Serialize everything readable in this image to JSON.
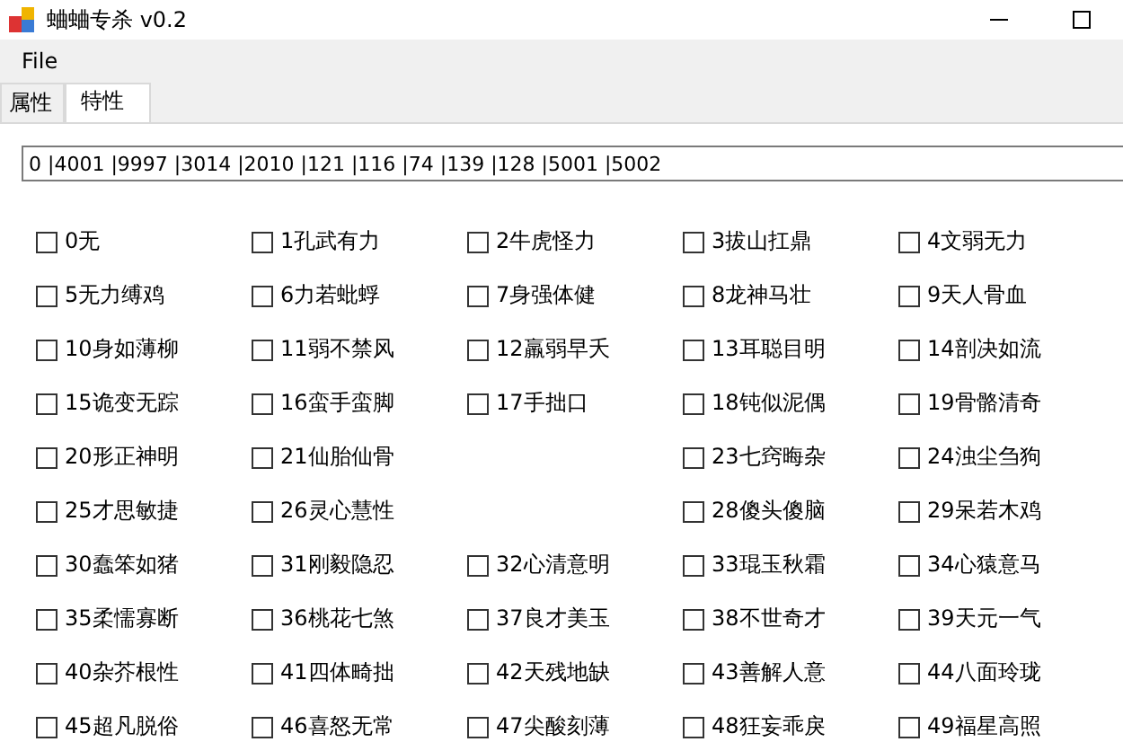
{
  "window": {
    "title": "蛐蛐专杀 v0.2"
  },
  "menu": [
    "File"
  ],
  "tabs": [
    {
      "label": "属性",
      "selected": false
    },
    {
      "label": "特性",
      "selected": true
    }
  ],
  "code_field": {
    "value": "0 |4001 |9997 |3014 |2010 |121 |116 |74 |139 |128 |5001 |5002"
  },
  "traits": [
    {
      "kind": "checkbox",
      "label": "0无",
      "checked": false
    },
    {
      "kind": "checkbox",
      "label": "1孔武有力",
      "checked": false
    },
    {
      "kind": "checkbox",
      "label": "2牛虎怪力",
      "checked": false
    },
    {
      "kind": "checkbox",
      "label": "3拔山扛鼎",
      "checked": false
    },
    {
      "kind": "checkbox",
      "label": "4文弱无力",
      "checked": false
    },
    {
      "kind": "checkbox",
      "label": "5无力缚鸡",
      "checked": false
    },
    {
      "kind": "checkbox",
      "label": "6力若蚍蜉",
      "checked": false
    },
    {
      "kind": "checkbox",
      "label": "7身强体健",
      "checked": false
    },
    {
      "kind": "checkbox",
      "label": "8龙神马壮",
      "checked": false
    },
    {
      "kind": "checkbox",
      "label": "9天人骨血",
      "checked": false
    },
    {
      "kind": "checkbox",
      "label": "10身如薄柳",
      "checked": false
    },
    {
      "kind": "checkbox",
      "label": "11弱不禁风",
      "checked": false
    },
    {
      "kind": "checkbox",
      "label": "12羸弱早夭",
      "checked": false
    },
    {
      "kind": "checkbox",
      "label": "13耳聪目明",
      "checked": false
    },
    {
      "kind": "checkbox",
      "label": "14剖决如流",
      "checked": false
    },
    {
      "kind": "checkbox",
      "label": "15诡变无踪",
      "checked": false
    },
    {
      "kind": "checkbox",
      "label": "16蛮手蛮脚",
      "checked": false
    },
    {
      "kind": "checkbox",
      "label": "17手拙口",
      "checked": false
    },
    {
      "kind": "checkbox",
      "label": "18钝似泥偶",
      "checked": false
    },
    {
      "kind": "checkbox",
      "label": "19骨骼清奇",
      "checked": false
    },
    {
      "kind": "checkbox",
      "label": "20形正神明",
      "checked": false
    },
    {
      "kind": "checkbox",
      "label": "21仙胎仙骨",
      "checked": false
    },
    {
      "kind": "blank"
    },
    {
      "kind": "checkbox",
      "label": "23七窍晦杂",
      "checked": false
    },
    {
      "kind": "checkbox",
      "label": "24浊尘刍狗",
      "checked": false
    },
    {
      "kind": "checkbox",
      "label": "25才思敏捷",
      "checked": false
    },
    {
      "kind": "checkbox",
      "label": "26灵心慧性",
      "checked": false
    },
    {
      "kind": "blank"
    },
    {
      "kind": "checkbox",
      "label": "28傻头傻脑",
      "checked": false
    },
    {
      "kind": "checkbox",
      "label": "29呆若木鸡",
      "checked": false
    },
    {
      "kind": "checkbox",
      "label": "30蠢笨如猪",
      "checked": false
    },
    {
      "kind": "checkbox",
      "label": "31刚毅隐忍",
      "checked": false
    },
    {
      "kind": "checkbox",
      "label": "32心清意明",
      "checked": false
    },
    {
      "kind": "checkbox",
      "label": "33琨玉秋霜",
      "checked": false
    },
    {
      "kind": "checkbox",
      "label": "34心猿意马",
      "checked": false
    },
    {
      "kind": "checkbox",
      "label": "35柔懦寡断",
      "checked": false
    },
    {
      "kind": "checkbox",
      "label": "36桃花七煞",
      "checked": false
    },
    {
      "kind": "checkbox",
      "label": "37良才美玉",
      "checked": false
    },
    {
      "kind": "checkbox",
      "label": "38不世奇才",
      "checked": false
    },
    {
      "kind": "checkbox",
      "label": "39天元一气",
      "checked": false
    },
    {
      "kind": "checkbox",
      "label": "40杂芥根性",
      "checked": false
    },
    {
      "kind": "checkbox",
      "label": "41四体畸拙",
      "checked": false
    },
    {
      "kind": "checkbox",
      "label": "42天残地缺",
      "checked": false
    },
    {
      "kind": "checkbox",
      "label": "43善解人意",
      "checked": false
    },
    {
      "kind": "checkbox",
      "label": "44八面玲珑",
      "checked": false
    },
    {
      "kind": "checkbox",
      "label": "45超凡脱俗",
      "checked": false
    },
    {
      "kind": "checkbox",
      "label": "46喜怒无常",
      "checked": false
    },
    {
      "kind": "checkbox",
      "label": "47尖酸刻薄",
      "checked": false
    },
    {
      "kind": "checkbox",
      "label": "48狂妄乖戾",
      "checked": false
    },
    {
      "kind": "checkbox",
      "label": "49福星高照",
      "checked": false
    }
  ]
}
